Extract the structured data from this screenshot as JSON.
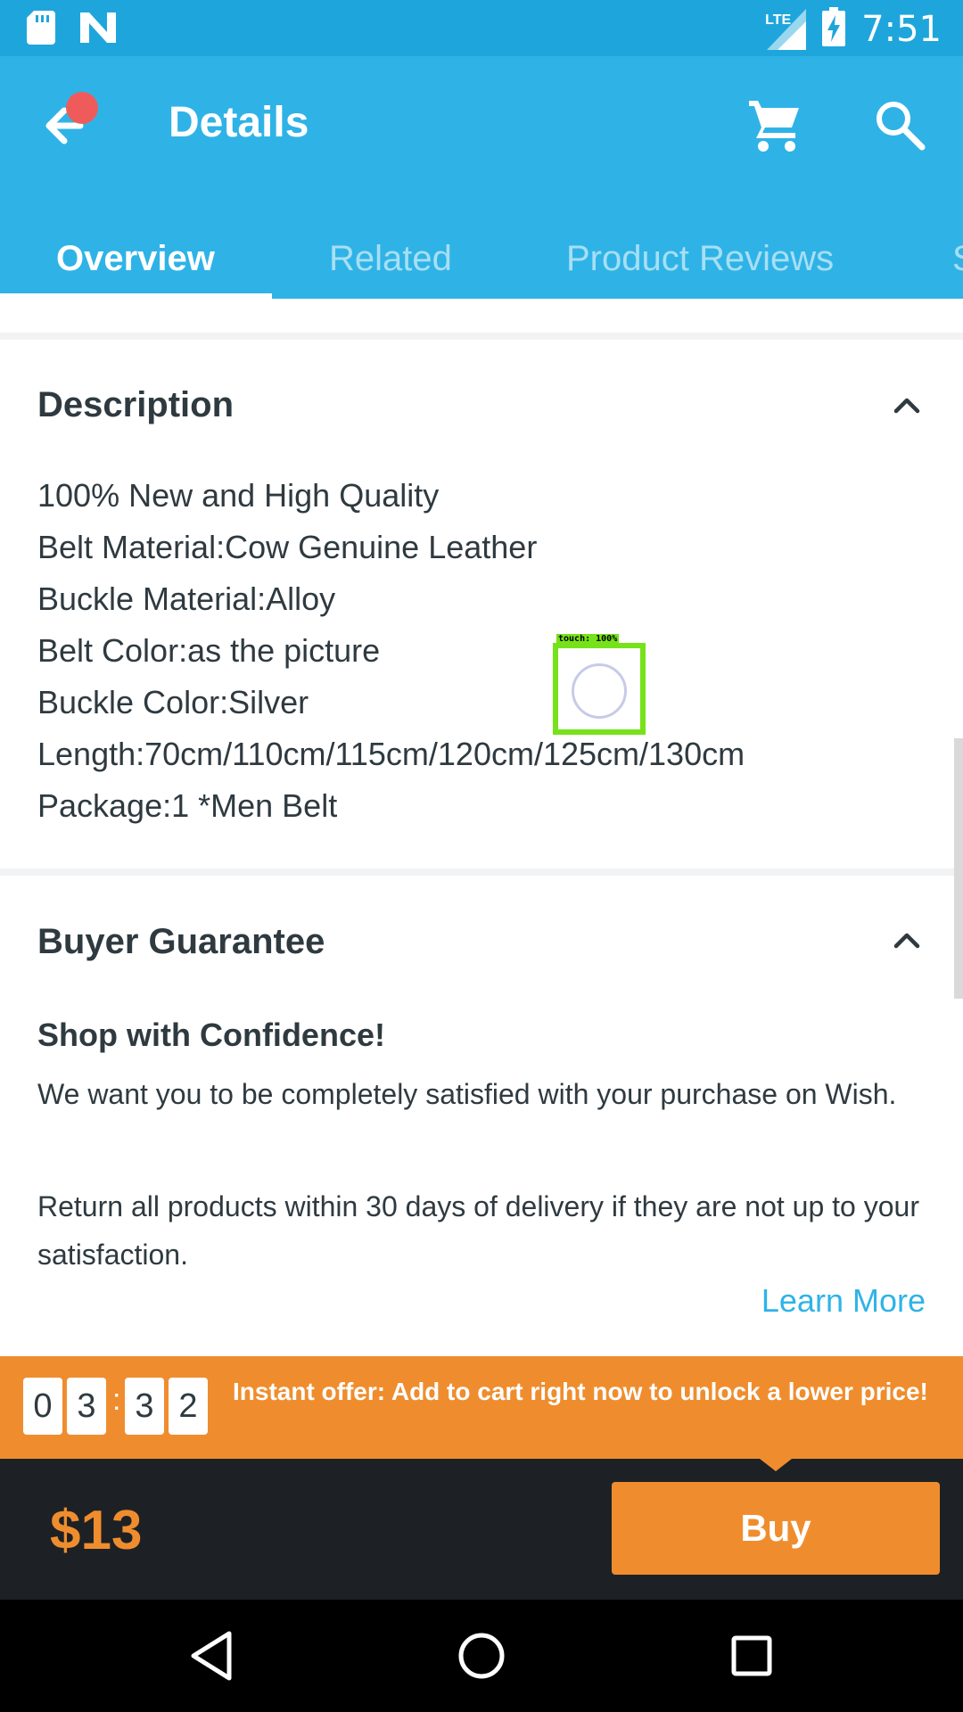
{
  "status_bar": {
    "time": "7:51",
    "network": "LTE",
    "icons": [
      "sd-card-icon",
      "n-app-icon",
      "signal-icon",
      "battery-charging-icon"
    ]
  },
  "app_bar": {
    "title": "Details",
    "icons": [
      "back-arrow-icon",
      "cart-icon",
      "search-icon"
    ],
    "tabs": [
      {
        "label": "Overview",
        "active": true
      },
      {
        "label": "Related",
        "active": false
      },
      {
        "label": "Product Reviews",
        "active": false
      },
      {
        "label": "S",
        "active": false
      }
    ]
  },
  "description": {
    "title": "Description",
    "lines": [
      "100% New and High Quality",
      "Belt Material:Cow Genuine Leather",
      "Buckle Material:Alloy",
      "Belt Color:as the picture",
      "Buckle Color:Silver",
      "Length:70cm/110cm/115cm/120cm/125cm/130cm",
      "Package:1 *Men Belt"
    ]
  },
  "buyer_guarantee": {
    "title": "Buyer Guarantee",
    "subtitle": "Shop with Confidence!",
    "paragraph1": "We want you to be completely satisfied with your purchase on Wish.",
    "paragraph2": "Return all products within 30 days of delivery if they are not up to your satisfaction.",
    "learn_more": "Learn More"
  },
  "touch_overlay": {
    "label": "touch: 100%"
  },
  "offer": {
    "timer_digits": [
      "0",
      "3",
      "3",
      "2"
    ],
    "separator": ":",
    "text": "Instant offer: Add to cart right now to unlock a lower price!"
  },
  "buy_bar": {
    "price": "$13",
    "buy_label": "Buy"
  },
  "colors": {
    "primary": "#2fb3e7",
    "status_bar": "#1ea6dc",
    "accent_orange": "#ef8d2e",
    "dark_bar": "#1d2125",
    "notification_dot": "#ef5b5b"
  }
}
